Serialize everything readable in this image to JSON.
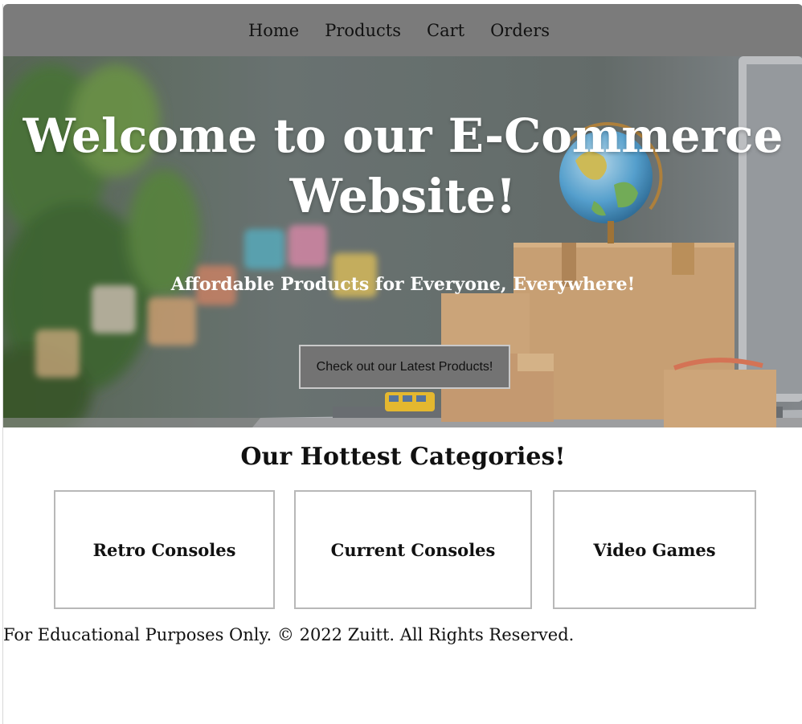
{
  "navbar": {
    "links": [
      "Home",
      "Products",
      "Cart",
      "Orders"
    ]
  },
  "hero": {
    "title": "Welcome to our E-Commerce Website!",
    "subtitle": "Affordable Products for Everyone, Everywhere!",
    "button_label": "Check out our Latest Products!"
  },
  "categories": {
    "heading": "Our Hottest Categories!",
    "items": [
      "Retro Consoles",
      "Current Consoles",
      "Video Games"
    ]
  },
  "footer": {
    "text": "For Educational Purposes Only. © 2022 Zuitt. All Rights Reserved."
  },
  "colors": {
    "navbar_bg": "#7b7b7b",
    "button_bg": "#737373",
    "hero_text": "#ffffff"
  }
}
